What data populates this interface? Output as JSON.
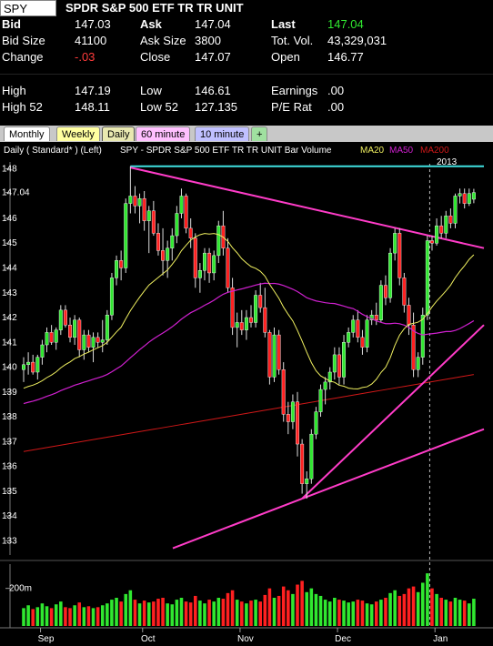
{
  "quote": {
    "symbol": "SPY",
    "name": "SPDR S&P 500 ETF TR TR UNIT",
    "rows": [
      [
        {
          "label": "Bid",
          "value": "147.03",
          "bold": true
        },
        {
          "label": "Ask",
          "value": "147.04",
          "bold": true
        },
        {
          "label": "Last",
          "value": "147.04",
          "bold": true,
          "class": "pos"
        }
      ],
      [
        {
          "label": "Bid Size",
          "value": "41100"
        },
        {
          "label": "Ask Size",
          "value": "3800"
        },
        {
          "label": "Tot. Vol.",
          "value": "43,329,031"
        }
      ],
      [
        {
          "label": "Change",
          "value": "-.03",
          "class": "neg"
        },
        {
          "label": "Close",
          "value": "147.07"
        },
        {
          "label": "Open",
          "value": "146.77"
        }
      ],
      [
        {
          "label": "High",
          "value": "147.19"
        },
        {
          "label": "Low",
          "value": "146.61"
        },
        {
          "label": "Earnings",
          "value": ".00"
        }
      ],
      [
        {
          "label": "High 52",
          "value": "148.11"
        },
        {
          "label": "Low 52",
          "value": "127.135"
        },
        {
          "label": "P/E Rat",
          "value": ".00"
        }
      ]
    ]
  },
  "tabs": [
    {
      "label": "Monthly",
      "bg": "#ffffff"
    },
    {
      "label": "Weekly",
      "bg": "#ffffa0"
    },
    {
      "label": "Daily",
      "bg": "#e8e8b0",
      "active": true
    },
    {
      "label": "60 minute",
      "bg": "#ffc0ff"
    },
    {
      "label": "10 minute",
      "bg": "#c0c0ff"
    },
    {
      "label": "+",
      "bg": "#a0e0a0"
    }
  ],
  "chart_header": {
    "prefix": "Daily ( Standard* )  (Left)",
    "title": "SPY - SPDR S&P 500 ETF TR TR UNIT  Bar Volume",
    "ma20": "MA20",
    "ma50": "MA50",
    "ma200": "MA200",
    "year": "2013"
  },
  "colors": {
    "up": "#30e830",
    "down": "#ff2020",
    "ma20": "#f0f060",
    "ma50": "#d020d0",
    "ma200": "#d01818",
    "trendline": "#ff3cc8",
    "resistance": "#40e0e0"
  },
  "chart_data": {
    "type": "candlestick",
    "ylim": [
      132.5,
      148.2
    ],
    "y_ticks": [
      "133",
      "134",
      "135",
      "136",
      "137",
      "138",
      "139",
      "140",
      "141",
      "142",
      "143",
      "144",
      "145",
      "146",
      "147.04",
      "148"
    ],
    "x_labels": [
      "Sep",
      "Oct",
      "Nov",
      "Dec",
      "Jan"
    ],
    "volume_label": "200m",
    "candles": [
      {
        "o": 139.9,
        "h": 140.4,
        "l": 139.4,
        "c": 140.1
      },
      {
        "o": 140.1,
        "h": 140.6,
        "l": 139.7,
        "c": 140.2
      },
      {
        "o": 140.2,
        "h": 140.5,
        "l": 139.7,
        "c": 139.8
      },
      {
        "o": 139.8,
        "h": 140.5,
        "l": 139.5,
        "c": 140.4
      },
      {
        "o": 140.4,
        "h": 141.1,
        "l": 140.1,
        "c": 140.9
      },
      {
        "o": 140.9,
        "h": 141.6,
        "l": 140.6,
        "c": 141.4
      },
      {
        "o": 141.4,
        "h": 141.7,
        "l": 140.9,
        "c": 141.0
      },
      {
        "o": 141.0,
        "h": 141.6,
        "l": 140.7,
        "c": 141.5
      },
      {
        "o": 141.5,
        "h": 142.5,
        "l": 141.3,
        "c": 142.3
      },
      {
        "o": 142.3,
        "h": 142.5,
        "l": 141.6,
        "c": 141.7
      },
      {
        "o": 141.7,
        "h": 142.0,
        "l": 141.0,
        "c": 141.2
      },
      {
        "o": 141.2,
        "h": 142.1,
        "l": 140.9,
        "c": 141.9
      },
      {
        "o": 141.9,
        "h": 142.0,
        "l": 140.4,
        "c": 140.7
      },
      {
        "o": 140.7,
        "h": 141.5,
        "l": 140.3,
        "c": 141.3
      },
      {
        "o": 141.3,
        "h": 141.5,
        "l": 140.6,
        "c": 140.8
      },
      {
        "o": 140.8,
        "h": 141.4,
        "l": 140.2,
        "c": 141.2
      },
      {
        "o": 141.2,
        "h": 141.4,
        "l": 140.8,
        "c": 141.0
      },
      {
        "o": 141.0,
        "h": 141.9,
        "l": 140.6,
        "c": 141.1
      },
      {
        "o": 141.1,
        "h": 142.3,
        "l": 140.9,
        "c": 142.1
      },
      {
        "o": 142.1,
        "h": 143.8,
        "l": 141.9,
        "c": 143.6
      },
      {
        "o": 143.6,
        "h": 144.5,
        "l": 143.3,
        "c": 144.3
      },
      {
        "o": 144.3,
        "h": 144.7,
        "l": 143.5,
        "c": 144.0
      },
      {
        "o": 144.0,
        "h": 146.8,
        "l": 143.8,
        "c": 146.6
      },
      {
        "o": 146.6,
        "h": 148.1,
        "l": 146.2,
        "c": 146.9
      },
      {
        "o": 146.9,
        "h": 147.3,
        "l": 146.2,
        "c": 146.5
      },
      {
        "o": 146.5,
        "h": 147.0,
        "l": 145.8,
        "c": 146.8
      },
      {
        "o": 146.8,
        "h": 147.1,
        "l": 145.5,
        "c": 145.9
      },
      {
        "o": 145.9,
        "h": 146.5,
        "l": 144.6,
        "c": 146.3
      },
      {
        "o": 146.3,
        "h": 146.7,
        "l": 145.3,
        "c": 145.4
      },
      {
        "o": 145.4,
        "h": 145.8,
        "l": 144.5,
        "c": 144.7
      },
      {
        "o": 144.7,
        "h": 145.6,
        "l": 143.7,
        "c": 144.3
      },
      {
        "o": 144.3,
        "h": 145.1,
        "l": 143.6,
        "c": 144.8
      },
      {
        "o": 144.8,
        "h": 145.6,
        "l": 144.3,
        "c": 145.3
      },
      {
        "o": 145.3,
        "h": 146.5,
        "l": 145.0,
        "c": 146.2
      },
      {
        "o": 146.2,
        "h": 147.2,
        "l": 146.0,
        "c": 146.9
      },
      {
        "o": 146.9,
        "h": 147.0,
        "l": 145.4,
        "c": 145.6
      },
      {
        "o": 145.6,
        "h": 146.0,
        "l": 144.8,
        "c": 145.2
      },
      {
        "o": 145.2,
        "h": 145.4,
        "l": 143.2,
        "c": 143.6
      },
      {
        "o": 143.6,
        "h": 144.2,
        "l": 143.0,
        "c": 143.9
      },
      {
        "o": 143.9,
        "h": 144.8,
        "l": 143.5,
        "c": 144.6
      },
      {
        "o": 144.6,
        "h": 144.8,
        "l": 143.4,
        "c": 143.8
      },
      {
        "o": 143.8,
        "h": 144.7,
        "l": 143.5,
        "c": 144.5
      },
      {
        "o": 144.5,
        "h": 145.9,
        "l": 144.2,
        "c": 145.7
      },
      {
        "o": 145.7,
        "h": 146.3,
        "l": 144.5,
        "c": 144.8
      },
      {
        "o": 144.8,
        "h": 145.2,
        "l": 143.0,
        "c": 143.2
      },
      {
        "o": 143.2,
        "h": 143.6,
        "l": 141.3,
        "c": 141.6
      },
      {
        "o": 141.6,
        "h": 142.2,
        "l": 140.8,
        "c": 141.8
      },
      {
        "o": 141.8,
        "h": 142.3,
        "l": 141.3,
        "c": 141.5
      },
      {
        "o": 141.5,
        "h": 142.3,
        "l": 141.1,
        "c": 142.0
      },
      {
        "o": 142.0,
        "h": 142.5,
        "l": 141.6,
        "c": 141.8
      },
      {
        "o": 141.8,
        "h": 143.1,
        "l": 141.6,
        "c": 142.9
      },
      {
        "o": 142.9,
        "h": 143.4,
        "l": 142.2,
        "c": 142.4
      },
      {
        "o": 142.4,
        "h": 143.2,
        "l": 141.2,
        "c": 141.4
      },
      {
        "o": 141.4,
        "h": 141.5,
        "l": 139.3,
        "c": 139.6
      },
      {
        "o": 139.6,
        "h": 141.6,
        "l": 139.4,
        "c": 141.3
      },
      {
        "o": 141.3,
        "h": 141.5,
        "l": 139.7,
        "c": 139.9
      },
      {
        "o": 139.9,
        "h": 140.2,
        "l": 137.8,
        "c": 138.1
      },
      {
        "o": 138.1,
        "h": 138.6,
        "l": 137.3,
        "c": 137.8
      },
      {
        "o": 137.8,
        "h": 138.9,
        "l": 137.5,
        "c": 138.6
      },
      {
        "o": 138.6,
        "h": 139.0,
        "l": 136.4,
        "c": 136.9
      },
      {
        "o": 136.9,
        "h": 137.1,
        "l": 134.9,
        "c": 135.3
      },
      {
        "o": 135.3,
        "h": 135.8,
        "l": 134.7,
        "c": 135.5
      },
      {
        "o": 135.5,
        "h": 137.5,
        "l": 135.3,
        "c": 137.3
      },
      {
        "o": 137.3,
        "h": 138.4,
        "l": 137.1,
        "c": 138.2
      },
      {
        "o": 138.2,
        "h": 139.3,
        "l": 138.0,
        "c": 139.1
      },
      {
        "o": 139.1,
        "h": 139.6,
        "l": 138.5,
        "c": 139.4
      },
      {
        "o": 139.4,
        "h": 140.0,
        "l": 139.1,
        "c": 139.8
      },
      {
        "o": 139.8,
        "h": 140.8,
        "l": 139.5,
        "c": 140.5
      },
      {
        "o": 140.5,
        "h": 140.8,
        "l": 139.3,
        "c": 139.6
      },
      {
        "o": 139.6,
        "h": 141.3,
        "l": 139.3,
        "c": 141.0
      },
      {
        "o": 141.0,
        "h": 141.6,
        "l": 140.8,
        "c": 141.4
      },
      {
        "o": 141.4,
        "h": 142.1,
        "l": 141.2,
        "c": 141.9
      },
      {
        "o": 141.9,
        "h": 142.3,
        "l": 141.0,
        "c": 141.2
      },
      {
        "o": 141.2,
        "h": 141.5,
        "l": 140.5,
        "c": 140.8
      },
      {
        "o": 140.8,
        "h": 142.1,
        "l": 140.6,
        "c": 141.9
      },
      {
        "o": 141.9,
        "h": 142.3,
        "l": 141.7,
        "c": 142.1
      },
      {
        "o": 142.1,
        "h": 142.6,
        "l": 141.7,
        "c": 141.9
      },
      {
        "o": 141.9,
        "h": 143.5,
        "l": 141.8,
        "c": 143.3
      },
      {
        "o": 143.3,
        "h": 143.7,
        "l": 142.5,
        "c": 142.8
      },
      {
        "o": 142.8,
        "h": 144.8,
        "l": 142.6,
        "c": 144.6
      },
      {
        "o": 144.6,
        "h": 145.6,
        "l": 144.3,
        "c": 145.4
      },
      {
        "o": 145.4,
        "h": 145.6,
        "l": 143.3,
        "c": 143.6
      },
      {
        "o": 143.6,
        "h": 143.8,
        "l": 142.2,
        "c": 142.5
      },
      {
        "o": 142.5,
        "h": 142.8,
        "l": 141.3,
        "c": 141.7
      },
      {
        "o": 141.7,
        "h": 142.2,
        "l": 139.6,
        "c": 139.9
      },
      {
        "o": 139.9,
        "h": 140.6,
        "l": 139.6,
        "c": 140.4
      },
      {
        "o": 140.4,
        "h": 142.4,
        "l": 140.1,
        "c": 142.1
      },
      {
        "o": 142.1,
        "h": 145.3,
        "l": 141.9,
        "c": 145.1
      },
      {
        "o": 145.1,
        "h": 145.3,
        "l": 144.7,
        "c": 145.0
      },
      {
        "o": 145.0,
        "h": 146.0,
        "l": 144.9,
        "c": 145.7
      },
      {
        "o": 145.7,
        "h": 146.1,
        "l": 145.2,
        "c": 145.4
      },
      {
        "o": 145.4,
        "h": 146.3,
        "l": 145.2,
        "c": 146.1
      },
      {
        "o": 146.1,
        "h": 146.4,
        "l": 145.6,
        "c": 145.8
      },
      {
        "o": 145.8,
        "h": 147.0,
        "l": 145.6,
        "c": 146.9
      },
      {
        "o": 146.9,
        "h": 147.2,
        "l": 146.6,
        "c": 147.0
      },
      {
        "o": 147.0,
        "h": 147.2,
        "l": 146.4,
        "c": 146.6
      },
      {
        "o": 146.6,
        "h": 147.2,
        "l": 146.5,
        "c": 147.0
      },
      {
        "o": 146.77,
        "h": 147.19,
        "l": 146.61,
        "c": 147.04
      }
    ],
    "volumes": [
      95,
      110,
      90,
      100,
      120,
      105,
      95,
      115,
      130,
      100,
      95,
      110,
      125,
      100,
      105,
      95,
      100,
      110,
      120,
      140,
      150,
      130,
      170,
      190,
      140,
      120,
      135,
      125,
      130,
      145,
      150,
      120,
      115,
      140,
      150,
      130,
      125,
      160,
      135,
      120,
      140,
      130,
      150,
      145,
      175,
      190,
      140,
      130,
      120,
      135,
      140,
      130,
      165,
      200,
      150,
      160,
      210,
      190,
      170,
      220,
      240,
      180,
      200,
      170,
      160,
      140,
      130,
      150,
      140,
      135,
      125,
      130,
      140,
      135,
      120,
      115,
      130,
      140,
      150,
      175,
      190,
      160,
      170,
      200,
      210,
      180,
      230,
      280,
      200,
      170,
      150,
      140,
      130,
      150,
      140,
      135,
      120,
      145
    ]
  }
}
